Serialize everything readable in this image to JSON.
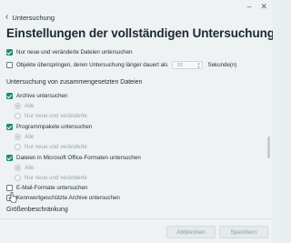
{
  "header": {
    "back_label": "Untersuchung",
    "title": "Einstellungen der vollständigen Untersuchung"
  },
  "general": {
    "only_new_changed": "Nur neue und veränderte Dateien untersuchen",
    "skip_objects_prefix": "Objekte überspringen, deren Untersuchung länger dauert als",
    "skip_seconds_value": "30",
    "skip_seconds_unit": "Sekunde(n)"
  },
  "compound": {
    "heading": "Untersuchung von zusammengesetzten Dateien",
    "archives_label": "Archive untersuchen",
    "archives_opt_all": "Alle",
    "archives_opt_new": "Nur neue und veränderte",
    "packages_label": "Programmpakete untersuchen",
    "packages_opt_all": "Alle",
    "packages_opt_new": "Nur neue und veränderte",
    "office_label": "Dateien in Microsoft Office-Formaten untersuchen",
    "office_opt_all": "Alle",
    "office_opt_new": "Nur neue und veränderte",
    "email_label": "E-Mail-Formate untersuchen",
    "password_archives_label": "Kennwortgeschützte Archive untersuchen"
  },
  "size": {
    "heading": "Größenbeschränkung"
  },
  "footer": {
    "cancel_label": "Abbrechen",
    "save_label": "Speichern"
  },
  "colors": {
    "accent": "#1d8c6f"
  }
}
